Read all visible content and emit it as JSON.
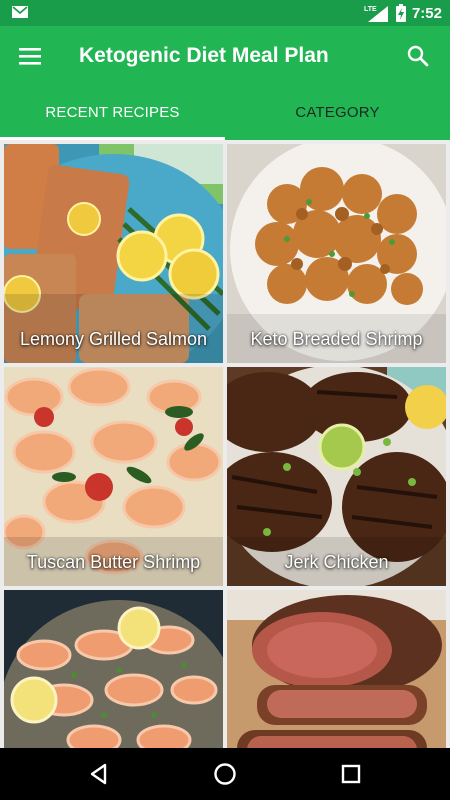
{
  "status_bar": {
    "time": "7:52",
    "network_label": "LTE",
    "icons": [
      "gmail-icon",
      "lte-signal-icon",
      "battery-charging-icon"
    ]
  },
  "app_bar": {
    "title": "Ketogenic Diet Meal Plan",
    "menu_icon": "hamburger-menu-icon",
    "search_icon": "search-icon",
    "background_color": "#22b554",
    "status_color": "#1a9d4b"
  },
  "tabs": [
    {
      "label": "RECENT RECIPES",
      "active": true
    },
    {
      "label": "CATEGORY",
      "active": false
    }
  ],
  "recipes": [
    {
      "title": "Lemony Grilled Salmon"
    },
    {
      "title": "Keto Breaded Shrimp"
    },
    {
      "title": "Tuscan Butter Shrimp"
    },
    {
      "title": "Jerk Chicken"
    },
    {
      "title": ""
    },
    {
      "title": ""
    }
  ],
  "nav_bar": {
    "icons": [
      "back-icon",
      "home-icon",
      "recent-apps-icon"
    ]
  }
}
